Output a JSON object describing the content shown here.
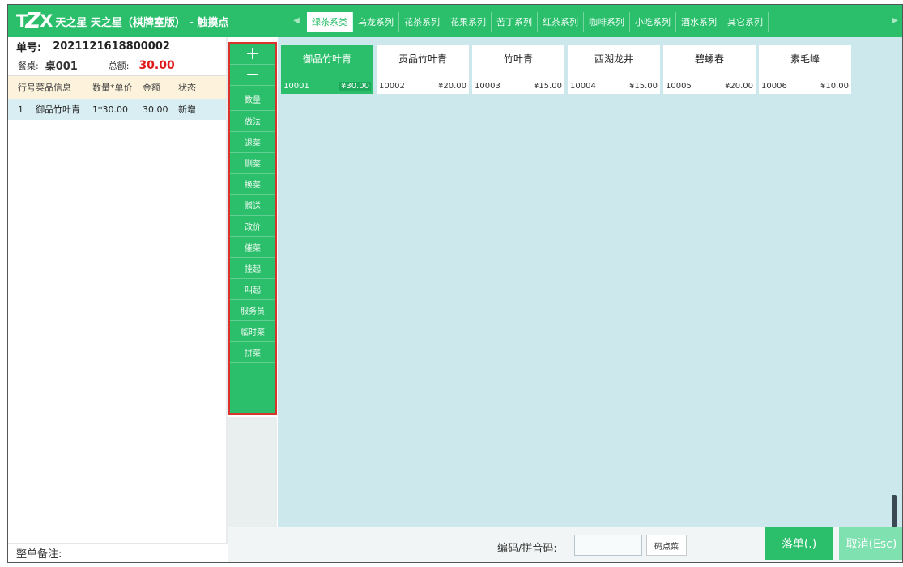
{
  "app": {
    "logo_text": "TZX",
    "title": "天之星 天之星（棋牌室版） - 触摸点单"
  },
  "order": {
    "number_label": "单号:",
    "number_value": "2021121618800002",
    "table_label": "餐桌:",
    "table_value": "桌001",
    "total_label": "总额:",
    "total_value": "30.00",
    "columns": [
      "行号",
      "菜品信息",
      "数量*单价",
      "金额",
      "状态"
    ],
    "rows": [
      {
        "line": "1",
        "name": "御品竹叶青",
        "qty_price": "1*30.00",
        "amount": "30.00",
        "status": "新增"
      }
    ],
    "remark_label": "整单备注:"
  },
  "actions": {
    "plus": "+",
    "minus": "−",
    "items": [
      "数量",
      "做法",
      "退菜",
      "删菜",
      "换菜",
      "赠送",
      "改价",
      "催菜",
      "挂起",
      "叫起",
      "服务员",
      "临时菜",
      "拼菜"
    ]
  },
  "tabs": [
    {
      "label": "绿茶系类",
      "active": true
    },
    {
      "label": "乌龙系列",
      "active": false
    },
    {
      "label": "花茶系列",
      "active": false
    },
    {
      "label": "花果系列",
      "active": false
    },
    {
      "label": "苦丁系列",
      "active": false
    },
    {
      "label": "红茶系列",
      "active": false
    },
    {
      "label": "咖啡系列",
      "active": false
    },
    {
      "label": "小吃系列",
      "active": false
    },
    {
      "label": "酒水系列",
      "active": false
    },
    {
      "label": "其它系列",
      "active": false
    }
  ],
  "products": [
    {
      "name": "御品竹叶青",
      "code": "10001",
      "price": "¥30.00",
      "active": true
    },
    {
      "name": "贡品竹叶青",
      "code": "10002",
      "price": "¥20.00",
      "active": false
    },
    {
      "name": "竹叶青",
      "code": "10003",
      "price": "¥15.00",
      "active": false
    },
    {
      "name": "西湖龙井",
      "code": "10004",
      "price": "¥15.00",
      "active": false
    },
    {
      "name": "碧螺春",
      "code": "10005",
      "price": "¥20.00",
      "active": false
    },
    {
      "name": "素毛峰",
      "code": "10006",
      "price": "¥10.00",
      "active": false
    }
  ],
  "bottom": {
    "code_label": "编码/拼音码:",
    "code_value": "",
    "code_button": "码点菜",
    "submit_button": "落单(.)",
    "cancel_button": "取消(Esc)"
  },
  "colors": {
    "brand_green": "#2bbf6c",
    "total_red": "#e01a1a",
    "highlight_border": "#d9342b"
  },
  "icons": {
    "tab_prev": "triangle-left-icon",
    "tab_next": "triangle-right-icon"
  }
}
